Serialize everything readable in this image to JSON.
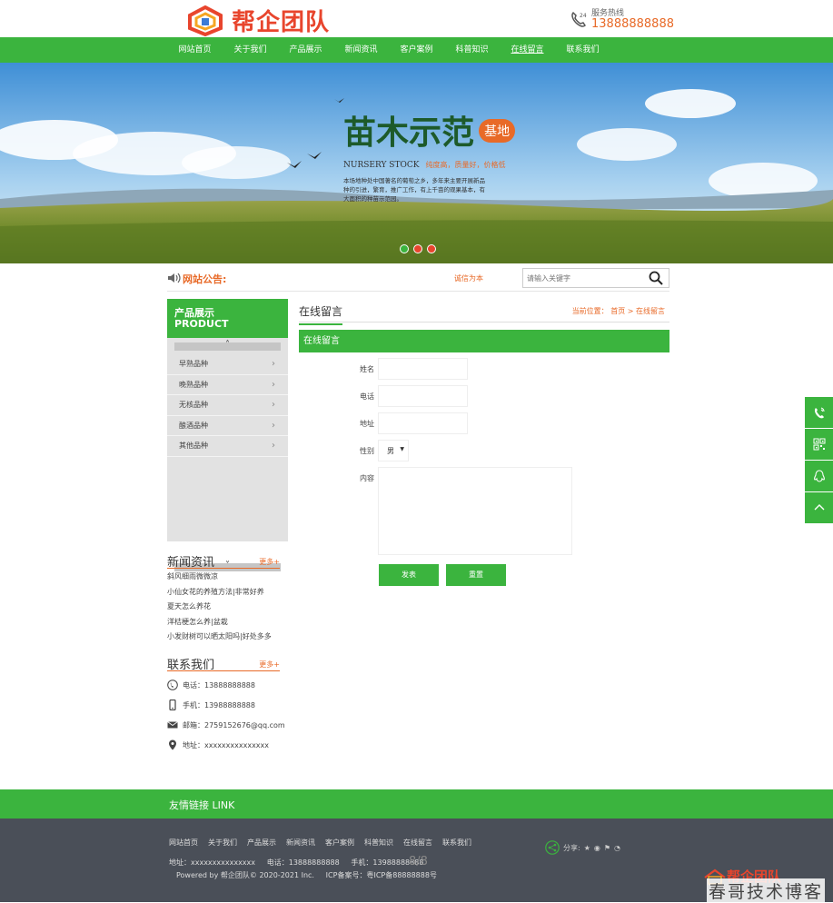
{
  "header": {
    "logo_text": "帮企团队",
    "hotline_label": "服务热线",
    "hotline_number": "13888888888"
  },
  "nav": {
    "items": [
      "网站首页",
      "关于我们",
      "产品展示",
      "新闻资讯",
      "客户案例",
      "科普知识",
      "在线留言",
      "联系我们"
    ],
    "active": "在线留言"
  },
  "banner": {
    "title": "苗木示范",
    "badge": "基地",
    "subtitle_en": "NURSERY STOCK",
    "subtitle_cn": "纯度高，质量好，价格低",
    "desc": [
      "本场地种处中国著名的葡萄之乡，多年来主要开展新品",
      "种的引进，繁育，推广工作，有上千亩的观果基本，有",
      "大面积的种苗示范园。"
    ]
  },
  "notice": {
    "label": "网站公告:",
    "text": "诚信为本",
    "search_placeholder": "请输入关键字"
  },
  "sidebar": {
    "title_cn": "产品展示",
    "title_en": "PRODUCT",
    "items": [
      "早熟品种",
      "晚熟品种",
      "无核品种",
      "酿酒品种",
      "其他品种"
    ]
  },
  "news": {
    "title": "新闻资讯",
    "more": "更多+",
    "items": [
      "斜风细雨微微凉",
      "小仙女花的养殖方法|非常好养",
      "夏天怎么养花",
      "洋桔梗怎么养|盆栽",
      "小发财树可以晒太阳吗|好处多多"
    ]
  },
  "contact": {
    "title": "联系我们",
    "more": "更多+",
    "phone": "电话：13888888888",
    "mobile": "手机：13988888888",
    "email": "邮箱：2759152676@qq.com",
    "address": "地址：xxxxxxxxxxxxxxx"
  },
  "main": {
    "title": "在线留言",
    "breadcrumb": "当前位置： 首页 > 在线留言",
    "form_head": "在线留言",
    "labels": {
      "name": "姓名",
      "phone": "电话",
      "address": "地址",
      "gender": "性别",
      "content": "内容"
    },
    "gender_value": "男",
    "submit": "发表",
    "reset": "重置"
  },
  "links": {
    "label": "友情链接 LINK"
  },
  "footer": {
    "nav": [
      "网站首页",
      "关于我们",
      "产品展示",
      "新闻资讯",
      "客户案例",
      "科普知识",
      "在线留言",
      "联系我们"
    ],
    "share_label": "分享:",
    "info": "地址：xxxxxxxxxxxxxxx     电话：13888888888     手机：13988888888",
    "copyright": "Powered by 帮企团队© 2020-2021 Inc.     ICP备案号：粤ICP备88888888号",
    "pager": "8/8",
    "watermark": "春哥技术博客",
    "watermark_logo": "帮企团队"
  },
  "colors": {
    "brand_green": "#3bb43e",
    "accent_orange": "#e86a28",
    "logo_red": "#e8452d",
    "footer_bg": "#4a4f58"
  }
}
